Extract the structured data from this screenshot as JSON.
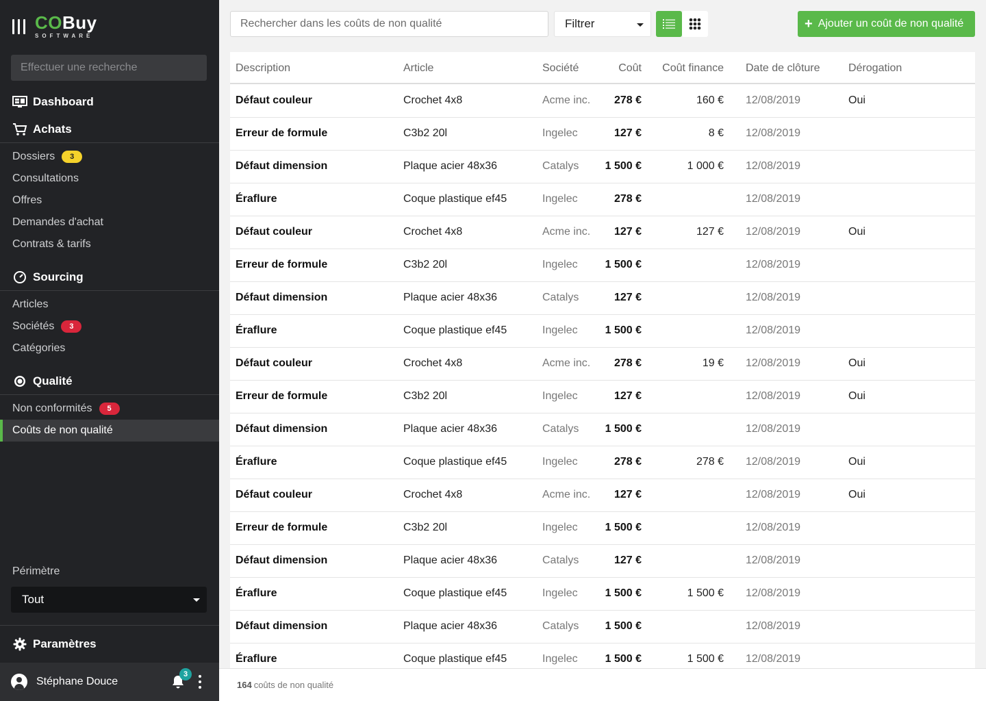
{
  "brand": {
    "co": "CO",
    "buy": "Buy",
    "sub": "SOFTWARE"
  },
  "sidebar": {
    "search_placeholder": "Effectuer une recherche",
    "dashboard": "Dashboard",
    "achats": {
      "label": "Achats",
      "items": [
        {
          "label": "Dossiers",
          "badge": "3"
        },
        {
          "label": "Consultations"
        },
        {
          "label": "Offres"
        },
        {
          "label": "Demandes d'achat"
        },
        {
          "label": "Contrats & tarifs"
        }
      ]
    },
    "sourcing": {
      "label": "Sourcing",
      "items": [
        {
          "label": "Articles"
        },
        {
          "label": "Sociétés",
          "badge": "3"
        },
        {
          "label": "Catégories"
        }
      ]
    },
    "qualite": {
      "label": "Qualité",
      "items": [
        {
          "label": "Non conformités",
          "badge": "5"
        },
        {
          "label": "Coûts de non qualité",
          "active": true
        }
      ]
    },
    "perimetre_label": "Périmètre",
    "perimetre_value": "Tout",
    "parametres": "Paramètres",
    "user_name": "Stéphane Douce",
    "notifications": "3"
  },
  "toolbar": {
    "search_placeholder": "Rechercher dans les coûts de non qualité",
    "filter_label": "Filtrer",
    "add_label": "Ajouter un coût de non qualité"
  },
  "table": {
    "headers": {
      "description": "Description",
      "article": "Article",
      "societe": "Société",
      "cout": "Coût",
      "cout_finance": "Coût finance",
      "date": "Date de clôture",
      "derogation": "Dérogation"
    },
    "rows": [
      {
        "description": "Défaut couleur",
        "article": "Crochet 4x8",
        "societe": "Acme inc.",
        "cout": "278 €",
        "cout_finance": "160 €",
        "date": "12/08/2019",
        "derogation": "Oui"
      },
      {
        "description": "Erreur de formule",
        "article": "C3b2 20l",
        "societe": "Ingelec",
        "cout": "127 €",
        "cout_finance": "8 €",
        "date": "12/08/2019",
        "derogation": ""
      },
      {
        "description": "Défaut dimension",
        "article": "Plaque acier 48x36",
        "societe": "Catalys",
        "cout": "1 500 €",
        "cout_finance": "1 000 €",
        "date": "12/08/2019",
        "derogation": ""
      },
      {
        "description": "Éraflure",
        "article": "Coque plastique ef45",
        "societe": "Ingelec",
        "cout": "278 €",
        "cout_finance": "",
        "date": "12/08/2019",
        "derogation": ""
      },
      {
        "description": "Défaut couleur",
        "article": "Crochet 4x8",
        "societe": "Acme inc.",
        "cout": "127 €",
        "cout_finance": "127 €",
        "date": "12/08/2019",
        "derogation": "Oui"
      },
      {
        "description": "Erreur de formule",
        "article": "C3b2 20l",
        "societe": "Ingelec",
        "cout": "1 500 €",
        "cout_finance": "",
        "date": "12/08/2019",
        "derogation": ""
      },
      {
        "description": "Défaut dimension",
        "article": "Plaque acier 48x36",
        "societe": "Catalys",
        "cout": "127 €",
        "cout_finance": "",
        "date": "12/08/2019",
        "derogation": ""
      },
      {
        "description": "Éraflure",
        "article": "Coque plastique ef45",
        "societe": "Ingelec",
        "cout": "1 500 €",
        "cout_finance": "",
        "date": "12/08/2019",
        "derogation": ""
      },
      {
        "description": "Défaut couleur",
        "article": "Crochet 4x8",
        "societe": "Acme inc.",
        "cout": "278 €",
        "cout_finance": "19 €",
        "date": "12/08/2019",
        "derogation": "Oui"
      },
      {
        "description": "Erreur de formule",
        "article": "C3b2 20l",
        "societe": "Ingelec",
        "cout": "127 €",
        "cout_finance": "",
        "date": "12/08/2019",
        "derogation": "Oui"
      },
      {
        "description": "Défaut dimension",
        "article": "Plaque acier 48x36",
        "societe": "Catalys",
        "cout": "1 500 €",
        "cout_finance": "",
        "date": "12/08/2019",
        "derogation": ""
      },
      {
        "description": "Éraflure",
        "article": "Coque plastique ef45",
        "societe": "Ingelec",
        "cout": "278 €",
        "cout_finance": "278 €",
        "date": "12/08/2019",
        "derogation": "Oui"
      },
      {
        "description": "Défaut couleur",
        "article": "Crochet 4x8",
        "societe": "Acme inc.",
        "cout": "127 €",
        "cout_finance": "",
        "date": "12/08/2019",
        "derogation": "Oui"
      },
      {
        "description": "Erreur de formule",
        "article": "C3b2 20l",
        "societe": "Ingelec",
        "cout": "1 500 €",
        "cout_finance": "",
        "date": "12/08/2019",
        "derogation": ""
      },
      {
        "description": "Défaut dimension",
        "article": "Plaque acier 48x36",
        "societe": "Catalys",
        "cout": "127 €",
        "cout_finance": "",
        "date": "12/08/2019",
        "derogation": ""
      },
      {
        "description": "Éraflure",
        "article": "Coque plastique ef45",
        "societe": "Ingelec",
        "cout": "1 500 €",
        "cout_finance": "1 500 €",
        "date": "12/08/2019",
        "derogation": ""
      },
      {
        "description": "Défaut dimension",
        "article": "Plaque acier 48x36",
        "societe": "Catalys",
        "cout": "1 500 €",
        "cout_finance": "",
        "date": "12/08/2019",
        "derogation": ""
      },
      {
        "description": "Éraflure",
        "article": "Coque plastique ef45",
        "societe": "Ingelec",
        "cout": "1 500 €",
        "cout_finance": "1 500 €",
        "date": "12/08/2019",
        "derogation": ""
      }
    ]
  },
  "footer": {
    "count": "164",
    "label": "coûts de non qualité"
  },
  "colors": {
    "accent": "#5ab94a",
    "sidebar_bg": "#222326",
    "badge_yellow": "#f5d22b",
    "badge_red": "#d9263b",
    "notif": "#1fa3a0"
  }
}
